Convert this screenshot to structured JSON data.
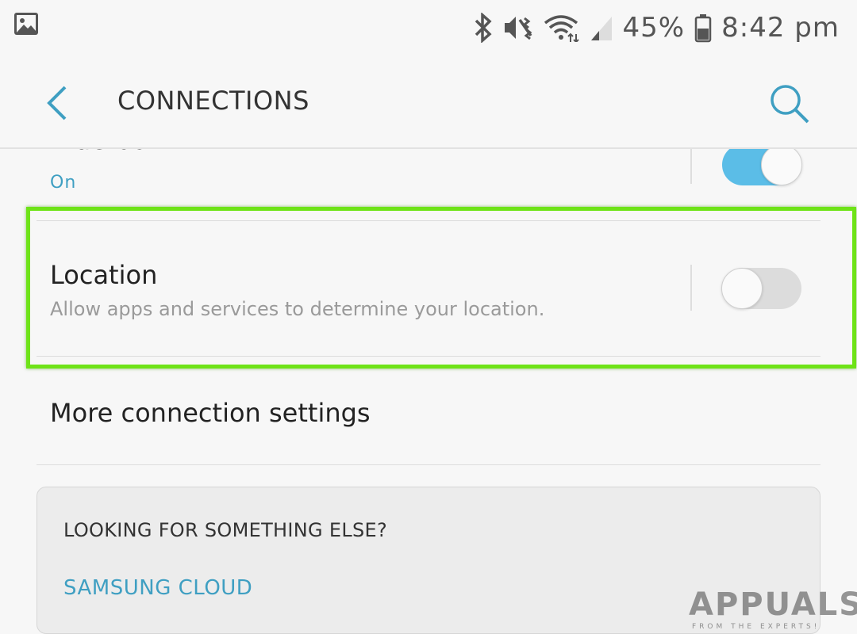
{
  "status_bar": {
    "battery_percent": "45%",
    "time": "8:42 pm",
    "icons": [
      "gallery-icon",
      "bluetooth-icon",
      "vibrate-icon",
      "wifi-icon",
      "signal-icon",
      "battery-icon"
    ]
  },
  "header": {
    "title": "CONNECTIONS",
    "back_icon": "chevron-left-icon",
    "search_icon": "search-icon"
  },
  "items": [
    {
      "title": "Bluetooth",
      "status": "On",
      "toggle_on": true
    },
    {
      "title": "Location",
      "subtitle": "Allow apps and services to determine your location.",
      "toggle_on": false,
      "highlighted": true
    },
    {
      "title": "More connection settings"
    }
  ],
  "card": {
    "heading": "LOOKING FOR SOMETHING ELSE?",
    "link": "SAMSUNG CLOUD"
  },
  "watermark": {
    "brand": "APPUALS",
    "tagline": "FROM THE EXPERTS!"
  },
  "colors": {
    "accent": "#3f9fc2",
    "toggle_on": "#5bbde7",
    "toggle_off": "#dcdcdc",
    "highlight": "#6ee317",
    "background": "#f7f7f7"
  }
}
